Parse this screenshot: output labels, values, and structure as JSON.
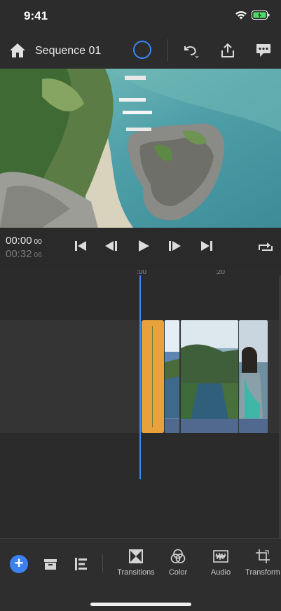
{
  "status": {
    "time": "9:41"
  },
  "header": {
    "title": "Sequence 01"
  },
  "transport": {
    "current_main": "00:00",
    "current_frames": "00",
    "total_main": "00:32",
    "total_frames": "06"
  },
  "timeline": {
    "ruler_labels": [
      ":00",
      ":20"
    ]
  },
  "toolbar": {
    "tools": [
      {
        "label": "Transitions",
        "icon": "transitions-icon"
      },
      {
        "label": "Color",
        "icon": "color-icon"
      },
      {
        "label": "Audio",
        "icon": "audio-icon"
      },
      {
        "label": "Transform",
        "icon": "transform-icon"
      }
    ]
  },
  "colors": {
    "accent": "#3b82f0",
    "clip_highlight": "#e9a23b",
    "battery": "#4cd964"
  }
}
